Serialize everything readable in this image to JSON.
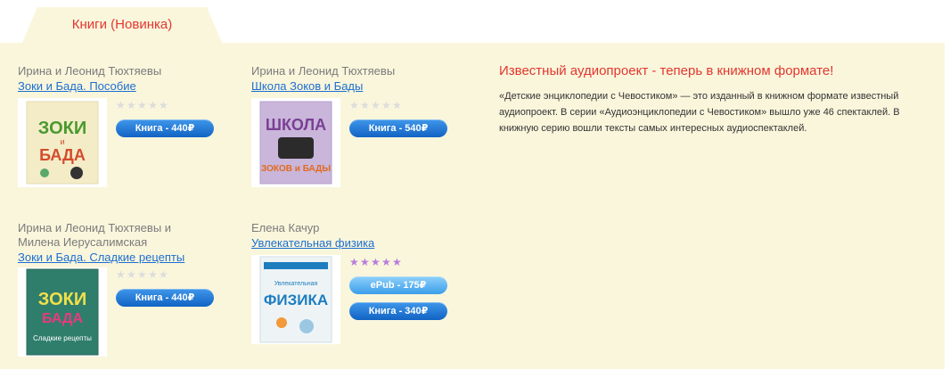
{
  "tab": {
    "label": "Книги (Новинка)"
  },
  "books": [
    {
      "author": "Ирина и Леонид Тюхтяевы",
      "title": "Зоки и Бада. Пособие",
      "rating": 0,
      "buttons": [
        {
          "label": "Книга - 440₽",
          "style": "dark"
        }
      ],
      "cover": {
        "bg": "#f3ecc7",
        "main": "ЗОКИ",
        "sub": "БАДА",
        "color": "#4a9a2f"
      }
    },
    {
      "author": "Ирина и Леонид Тюхтяевы",
      "title": "Школа Зоков и Бады",
      "rating": 0,
      "buttons": [
        {
          "label": "Книга - 540₽",
          "style": "dark"
        }
      ],
      "cover": {
        "bg": "#c9b6da",
        "main": "ШКОЛА",
        "sub": "ЗОКОВ и БАДЫ",
        "color": "#7a3f93"
      }
    },
    {
      "author": "Ирина и Леонид Тюхтяевы и Милена Иерусалимская",
      "title": "Зоки и Бада. Сладкие рецепты",
      "rating": 0,
      "buttons": [
        {
          "label": "Книга - 440₽",
          "style": "dark"
        }
      ],
      "cover": {
        "bg": "#2f7e6c",
        "main": "ЗОКИ",
        "sub": "Сладкие рецепты",
        "color": "#f1e04a"
      }
    },
    {
      "author": "Елена Качур",
      "title": "Увлекательная физика",
      "rating": 5,
      "buttons": [
        {
          "label": "ePub - 175₽",
          "style": "light"
        },
        {
          "label": "Книга - 340₽",
          "style": "dark"
        }
      ],
      "cover": {
        "bg": "#eef4f6",
        "main": "ФИЗИКА",
        "sub": "Увлекательная",
        "color": "#1e7dbf"
      }
    }
  ],
  "promo": {
    "title": "Известный аудиопроект - теперь в книжном формате!",
    "text": "«Детские энциклопедии с Чевостиком» — это изданный в книжном формате известный аудиопроект. В серии «Аудиоэнциклопедии с Чевостиком» вышло уже 46 спектаклей. В книжную серию вошли тексты самых интересных аудиоспектаклей."
  }
}
